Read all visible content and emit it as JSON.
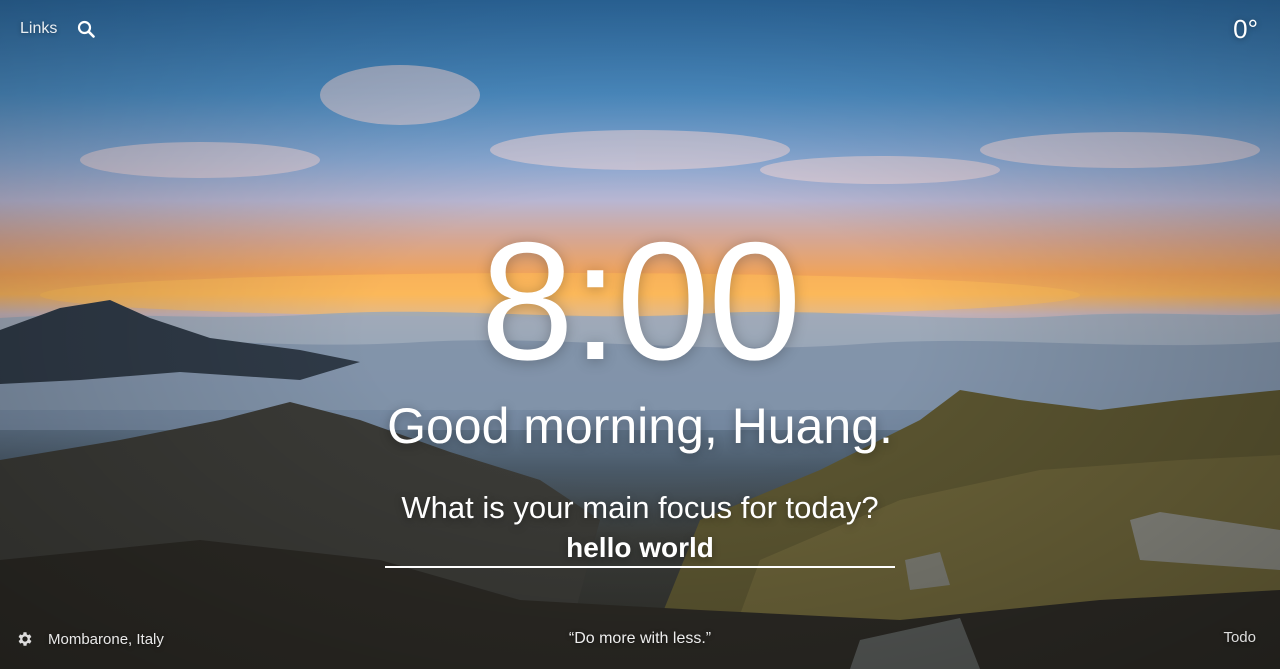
{
  "header": {
    "links_label": "Links",
    "search_icon": "search-icon",
    "temperature": "0°"
  },
  "main": {
    "time": "8:00",
    "greeting": "Good morning, Huang.",
    "focus_prompt": "What is your main focus for today?",
    "focus_value": "hello world"
  },
  "footer": {
    "settings_icon": "gear-icon",
    "location": "Mombarone, Italy",
    "quote": "“Do more with less.”",
    "todo_label": "Todo"
  }
}
